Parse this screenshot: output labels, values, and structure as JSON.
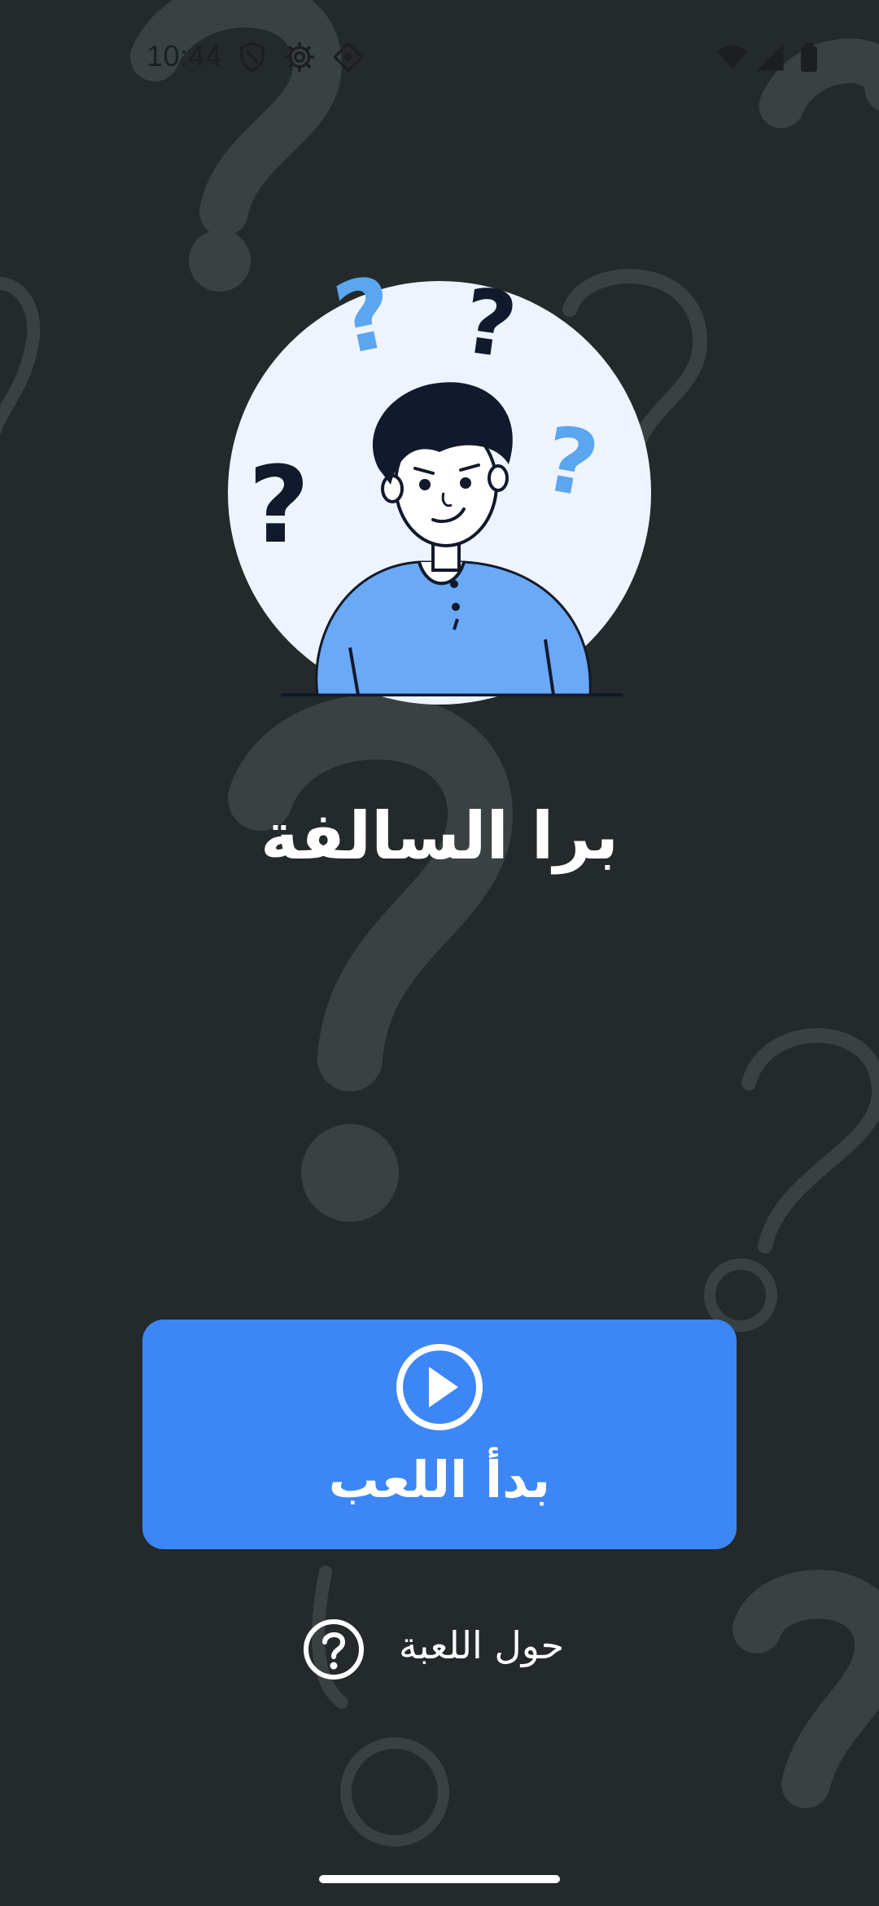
{
  "status_bar": {
    "time": "10:44",
    "left_icons": [
      "shield-icon",
      "gear-icon",
      "location-diamond-icon"
    ],
    "right_icons": [
      "wifi-icon",
      "cell-signal-icon",
      "battery-icon"
    ]
  },
  "app": {
    "title": "برا السالفة"
  },
  "start_button": {
    "label": "بدأ اللعب",
    "icon": "play-circle-icon"
  },
  "about_link": {
    "label": "حول اللعبة",
    "icon": "help-circle-icon"
  },
  "colors": {
    "background": "#24292b",
    "accent": "#3d86f6",
    "illustration_circle": "#eef4fd",
    "shirt": "#6aa9f5",
    "ink": "#111a2c",
    "light_question": "#5aa6ef"
  }
}
